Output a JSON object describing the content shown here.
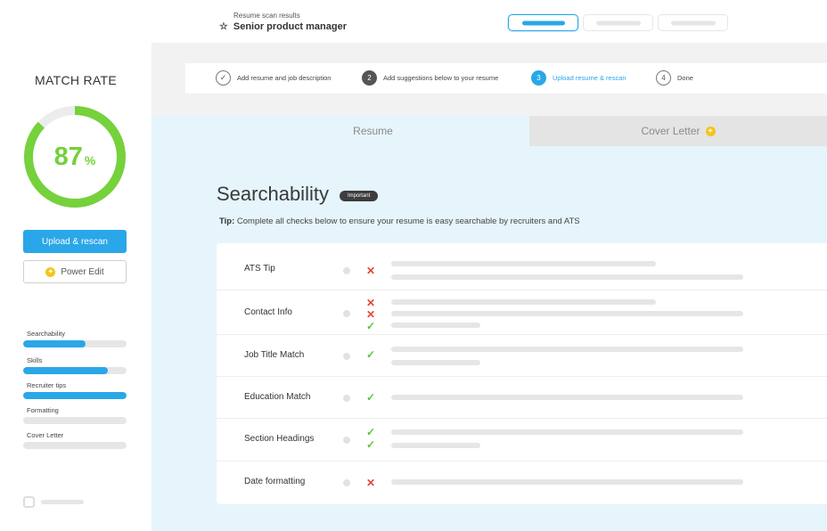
{
  "header": {
    "subtitle": "Resume scan results",
    "title": "Senior product manager",
    "star_icon": "star-icon",
    "view_pills": [
      {
        "active": true
      },
      {
        "active": false
      },
      {
        "active": false
      }
    ]
  },
  "sidebar": {
    "match_rate_title": "MATCH RATE",
    "match_rate_value": "87",
    "match_rate_unit": "%",
    "match_rate_fraction": 0.87,
    "upload_label": "Upload & rescan",
    "power_edit_label": "Power Edit",
    "categories": [
      {
        "label": "Searchability",
        "progress": 0.6
      },
      {
        "label": "Skills",
        "progress": 0.82
      },
      {
        "label": "Recruiter tips",
        "progress": 1.0
      },
      {
        "label": "Formatting",
        "progress": 0
      },
      {
        "label": "Cover Letter",
        "progress": 0
      }
    ]
  },
  "steps": [
    {
      "number": "✓",
      "label": "Add resume and job description",
      "state": "done"
    },
    {
      "number": "2",
      "label": "Add suggestions below to your resume",
      "state": "dark"
    },
    {
      "number": "3",
      "label": "Upload resume & rescan",
      "state": "current"
    },
    {
      "number": "4",
      "label": "Done",
      "state": "pending"
    }
  ],
  "tabs": {
    "resume": "Resume",
    "cover_letter": "Cover Letter"
  },
  "section": {
    "title": "Searchability",
    "badge": "Important",
    "tip_prefix": "Tip:",
    "tip_text": " Complete all checks below to ensure your resume is easy searchable by recruiters and ATS"
  },
  "checks": [
    {
      "label": "ATS Tip",
      "marks": [
        "fail"
      ]
    },
    {
      "label": "Contact Info",
      "marks": [
        "fail",
        "fail",
        "pass"
      ]
    },
    {
      "label": "Job Title Match",
      "marks": [
        "pass"
      ]
    },
    {
      "label": "Education Match",
      "marks": [
        "pass"
      ]
    },
    {
      "label": "Section Headings",
      "marks": [
        "pass",
        "pass"
      ]
    },
    {
      "label": "Date formatting",
      "marks": [
        "fail"
      ]
    }
  ],
  "colors": {
    "accent": "#2aa7e8",
    "match_green": "#75d13c",
    "pass": "#5bc43a",
    "fail": "#e2473a",
    "coin": "#f5c518"
  }
}
